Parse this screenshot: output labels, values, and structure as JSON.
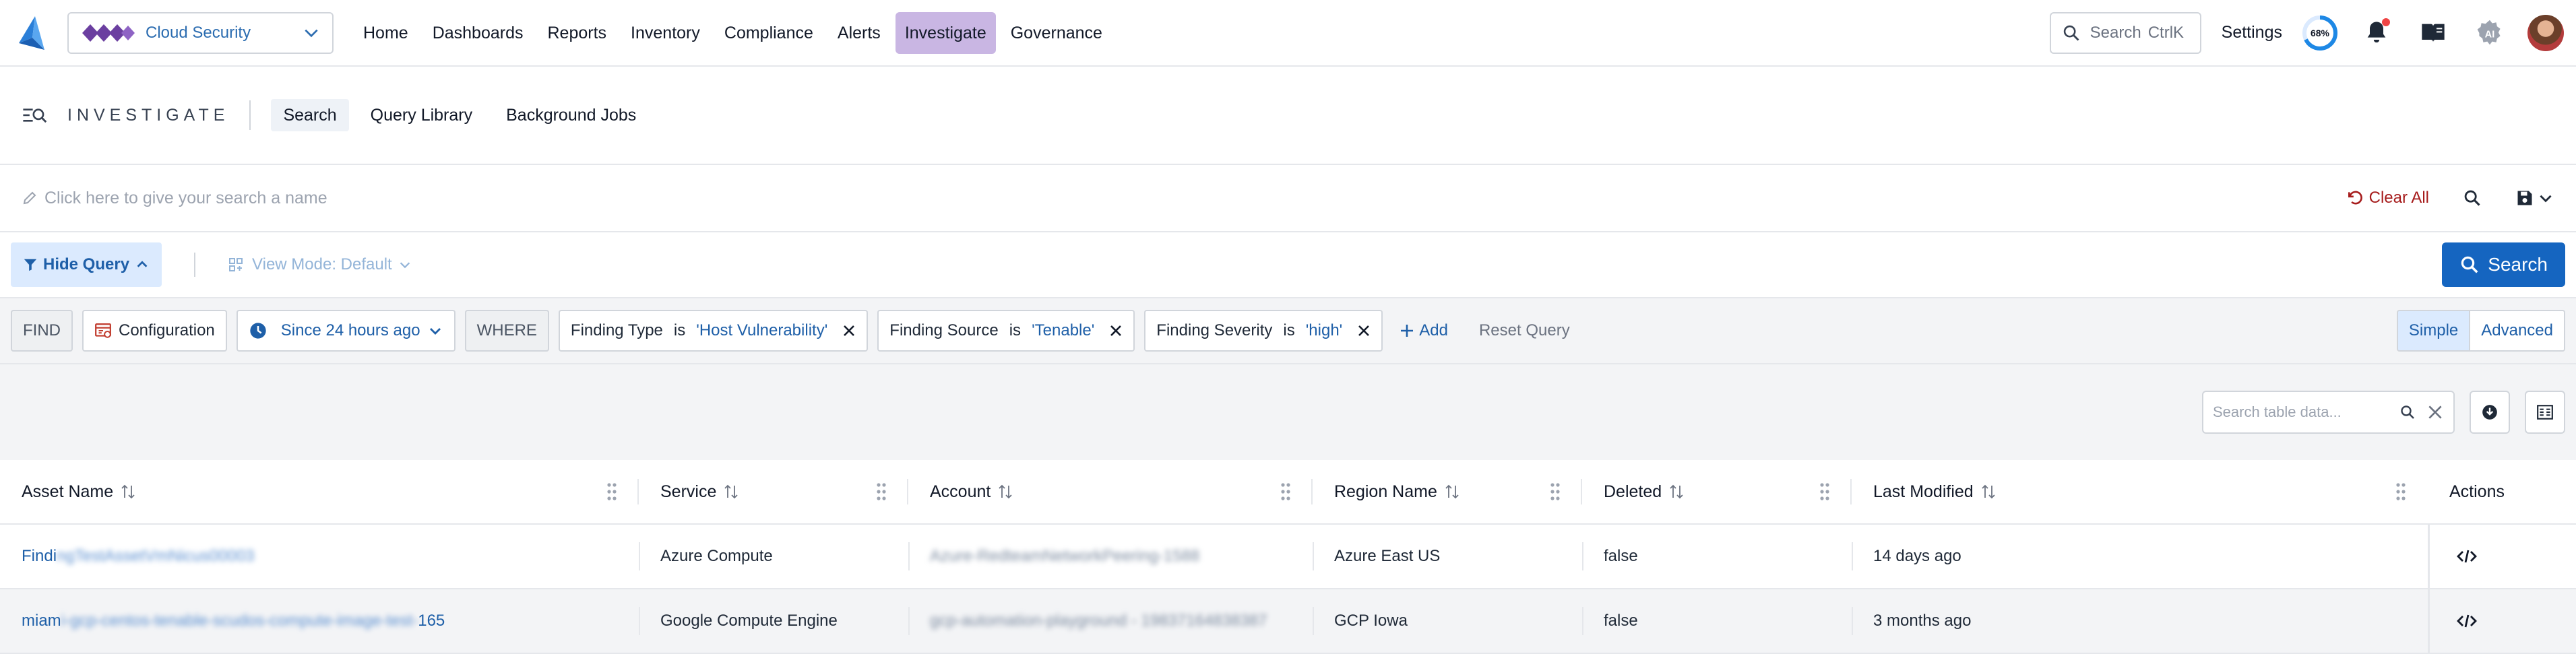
{
  "topnav": {
    "app_selector": "Cloud Security",
    "items": [
      {
        "label": "Home"
      },
      {
        "label": "Dashboards"
      },
      {
        "label": "Reports"
      },
      {
        "label": "Inventory"
      },
      {
        "label": "Compliance"
      },
      {
        "label": "Alerts"
      },
      {
        "label": "Investigate",
        "active": true
      },
      {
        "label": "Governance"
      }
    ],
    "search_placeholder": "Search",
    "search_shortcut": "CtrlK",
    "settings": "Settings",
    "progress_percent": "68%",
    "accent": "#1565c0"
  },
  "investigate": {
    "title": "INVESTIGATE",
    "tabs": [
      "Search",
      "Query Library",
      "Background Jobs"
    ]
  },
  "search_name": {
    "placeholder": "Click here to give your search a name",
    "clear_all": "Clear All"
  },
  "query_bar": {
    "hide_query": "Hide Query",
    "view_mode": "View Mode: Default",
    "search_button": "Search"
  },
  "filters": {
    "find_label": "FIND",
    "entity": "Configuration",
    "time_range": "Since 24 hours ago",
    "where_label": "WHERE",
    "conditions": [
      {
        "field": "Finding Type",
        "op": "is",
        "value": "'Host Vulnerability'"
      },
      {
        "field": "Finding Source",
        "op": "is",
        "value": "'Tenable'"
      },
      {
        "field": "Finding Severity",
        "op": "is",
        "value": "'high'"
      }
    ],
    "add": "Add",
    "reset": "Reset Query",
    "mode_simple": "Simple",
    "mode_advanced": "Advanced"
  },
  "table": {
    "search_placeholder": "Search table data...",
    "columns": [
      "Asset Name",
      "Service",
      "Account",
      "Region Name",
      "Deleted",
      "Last Modified",
      "Actions"
    ],
    "rows": [
      {
        "asset_prefix": "Findi",
        "asset_rest": "ngTestAssetVmNicus00003",
        "asset_suffix": "",
        "service": "Azure Compute",
        "account": "Azure-RedteamNetworkPeering-1588",
        "region": "Azure East US",
        "deleted": "false",
        "last_modified": "14 days ago"
      },
      {
        "asset_prefix": "miam",
        "asset_rest": "i-gcp-centos-tenable-scudos-compute-image-test-",
        "asset_suffix": "165",
        "service": "Google Compute Engine",
        "account": "gcp-automation-playground - 19837164838387",
        "region": "GCP Iowa",
        "deleted": "false",
        "last_modified": "3 months ago"
      }
    ]
  }
}
